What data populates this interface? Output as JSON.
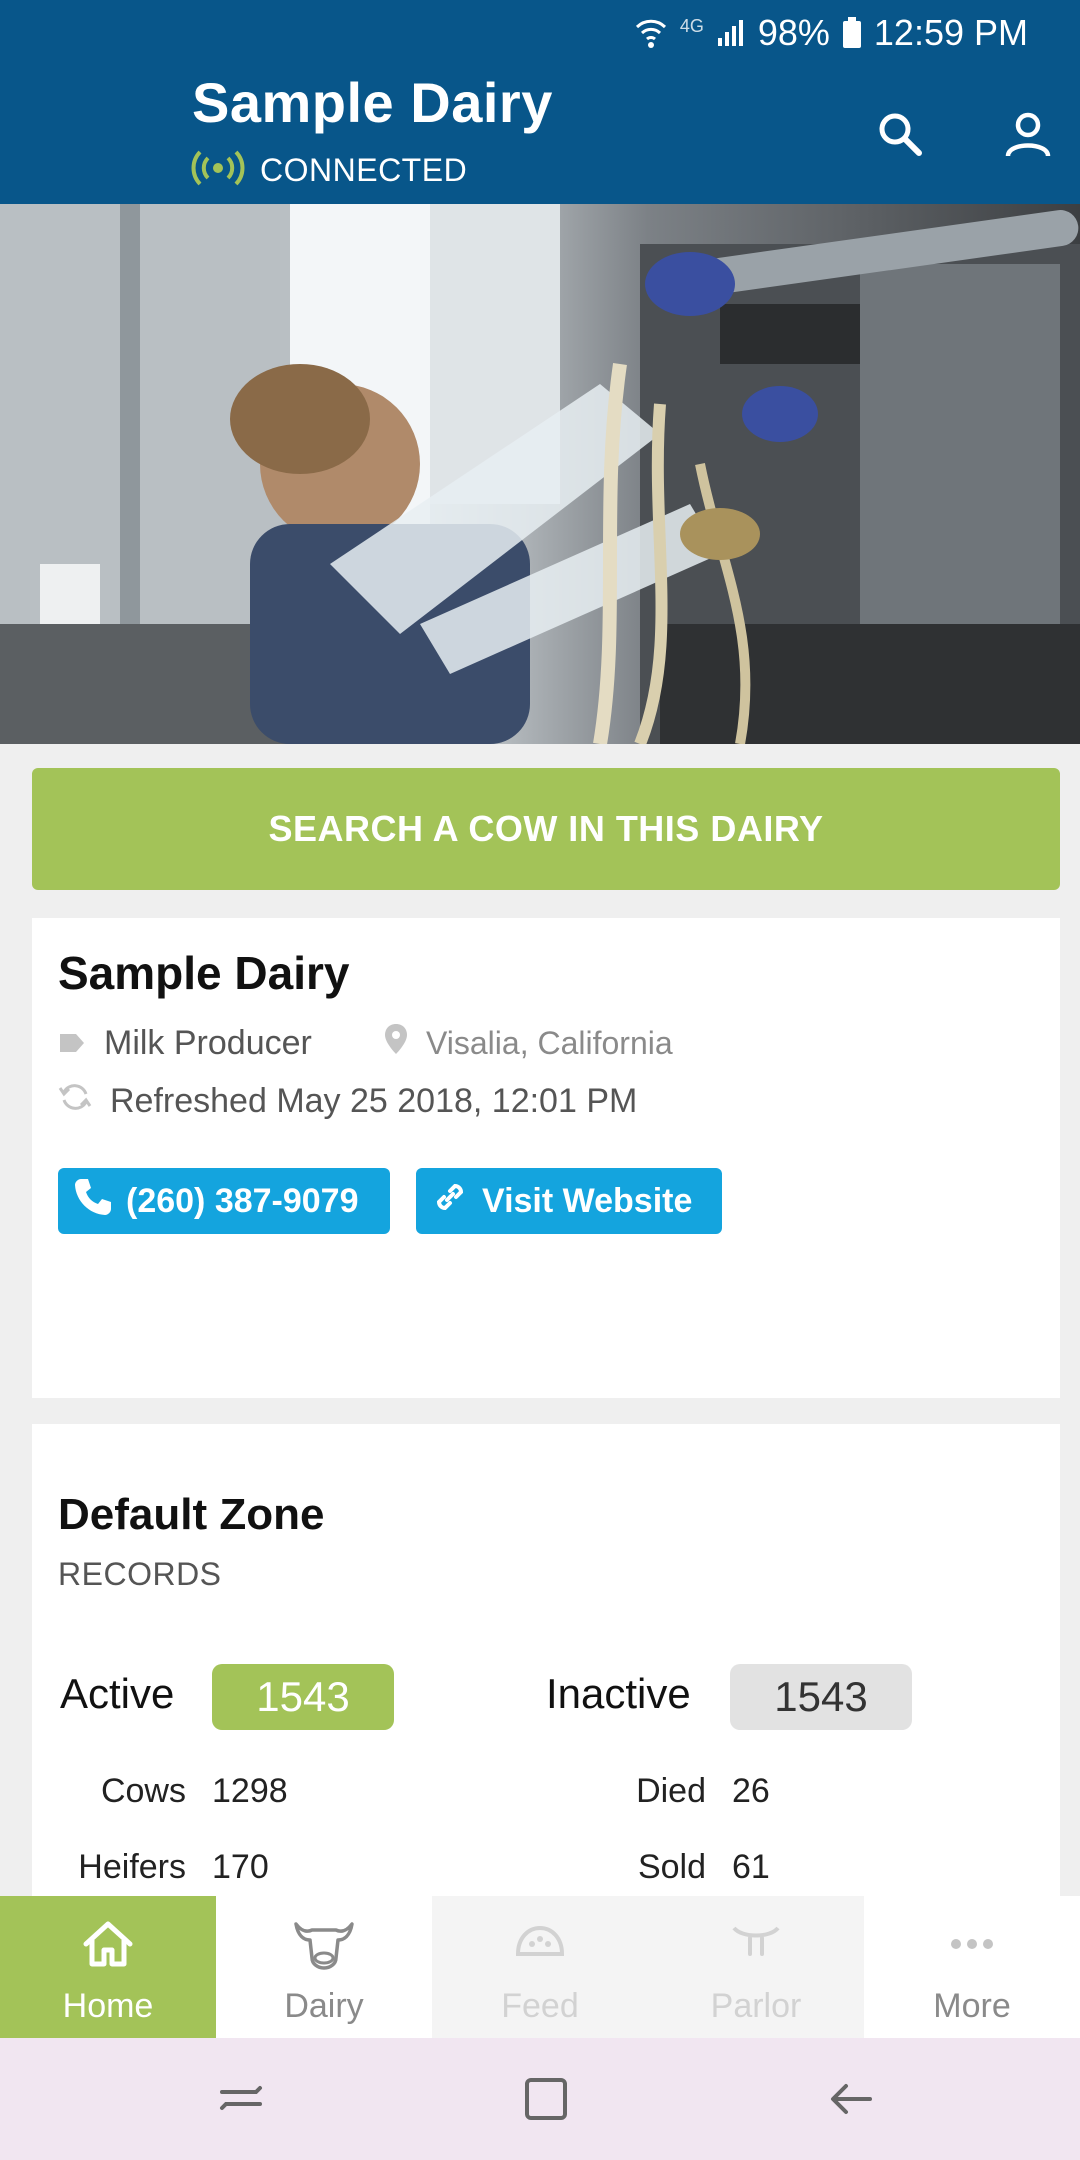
{
  "status_bar": {
    "network": "4G",
    "battery": "98%",
    "time": "12:59 PM"
  },
  "header": {
    "title": "Sample Dairy",
    "connection_status": "CONNECTED"
  },
  "search_cow_button": "SEARCH A COW IN THIS DAIRY",
  "dairy": {
    "name": "Sample Dairy",
    "type": "Milk Producer",
    "location": "Visalia, California",
    "refreshed": "Refreshed May 25 2018, 12:01 PM",
    "phone": "(260) 387-9079",
    "website_label": "Visit Website"
  },
  "zone": {
    "title": "Default Zone",
    "subtitle": "RECORDS",
    "active_label": "Active",
    "active_count": "1543",
    "inactive_label": "Inactive",
    "inactive_count": "1543",
    "left_records": [
      {
        "label": "Cows",
        "value": "1298"
      },
      {
        "label": "Heifers",
        "value": "170"
      }
    ],
    "right_records": [
      {
        "label": "Died",
        "value": "26"
      },
      {
        "label": "Sold",
        "value": "61"
      }
    ]
  },
  "bottom_nav": {
    "items": [
      {
        "label": "Home"
      },
      {
        "label": "Dairy"
      },
      {
        "label": "Feed"
      },
      {
        "label": "Parlor"
      },
      {
        "label": "More"
      }
    ]
  },
  "colors": {
    "header_blue": "#08568a",
    "accent_green": "#a3c358",
    "button_blue": "#14a4de"
  }
}
